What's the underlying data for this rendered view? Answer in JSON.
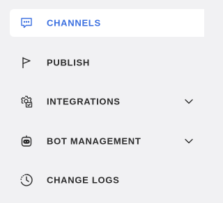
{
  "colors": {
    "background": "#f1f1f3",
    "active_background": "#ffffff",
    "active_text": "#3a6fe0",
    "text": "#2b2b2b"
  },
  "sidebar": {
    "items": [
      {
        "label": "CHANNELS",
        "icon": "chat-bubble-icon",
        "active": true,
        "expandable": false
      },
      {
        "label": "PUBLISH",
        "icon": "flag-icon",
        "active": false,
        "expandable": false
      },
      {
        "label": "INTEGRATIONS",
        "icon": "integrations-gear-icon",
        "active": false,
        "expandable": true
      },
      {
        "label": "BOT MANAGEMENT",
        "icon": "bot-icon",
        "active": false,
        "expandable": true
      },
      {
        "label": "CHANGE LOGS",
        "icon": "clock-history-icon",
        "active": false,
        "expandable": false
      }
    ]
  }
}
